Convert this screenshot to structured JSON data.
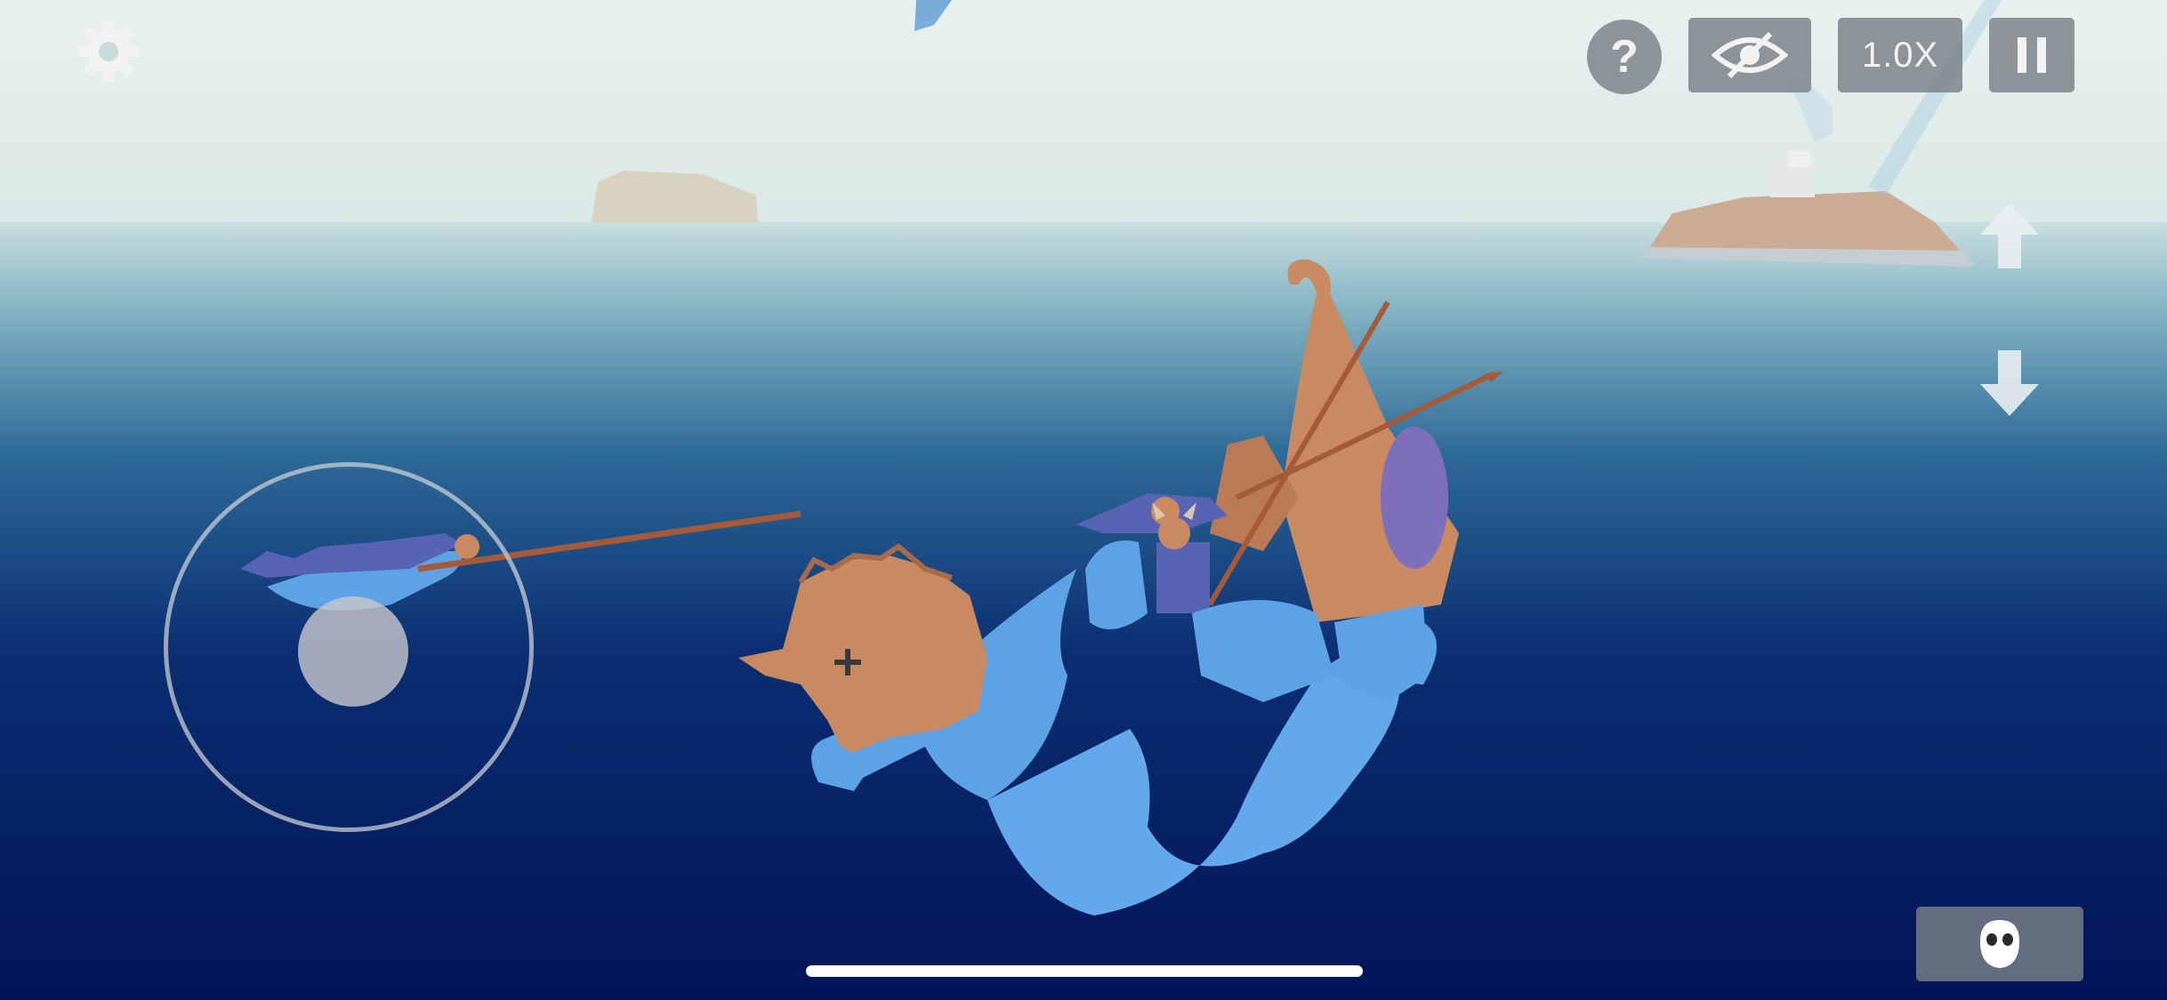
{
  "hud": {
    "settings_icon": "gear-icon",
    "help_icon": "question-mark-icon",
    "hide_ui_icon": "eye-slash-icon",
    "speed_label": "1.0X",
    "pause_icon": "pause-icon",
    "camera_up_icon": "arrow-up-icon",
    "camera_down_icon": "arrow-down-icon",
    "unit_select_icon": "ghost-face-icon"
  },
  "colors": {
    "sky": "#e4efec",
    "water_deep": "#03155a",
    "water_mid": "#1f5a8c",
    "hud_button": "#7a8086",
    "unit_skin": "#c98a62",
    "unit_cloth": "#5a64b8",
    "water_splash": "#5ea2e6"
  }
}
